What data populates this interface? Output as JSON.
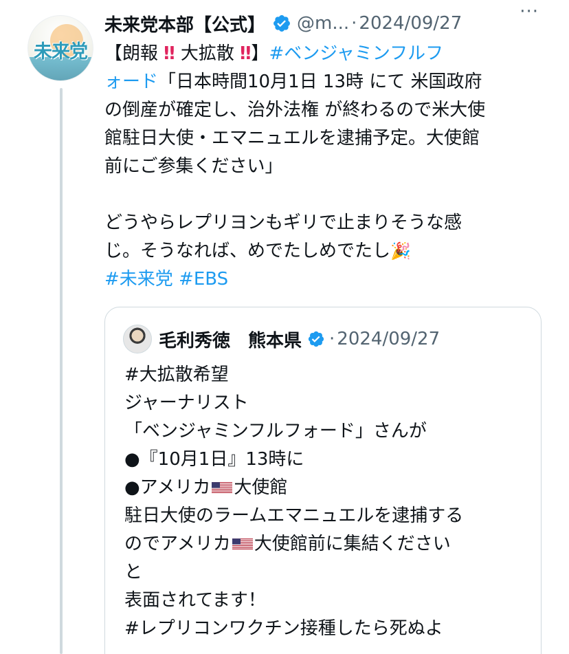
{
  "post": {
    "avatar_text": "未来党",
    "author_name": "未来党本部【公式】",
    "handle": "@m...",
    "separator": "·",
    "date": "2024/09/27",
    "more": "···",
    "lines": [
      [
        {
          "t": "【朗報 "
        },
        {
          "t": "‼",
          "c": "red"
        },
        {
          "t": " 大拡散 "
        },
        {
          "t": "‼",
          "c": "red"
        },
        {
          "t": "】"
        },
        {
          "t": "#ベンジャミンフルフ",
          "c": "blue"
        }
      ],
      [
        {
          "t": "ォード",
          "c": "blue"
        },
        {
          "t": "「日本時間10月1日 13時 にて 米国政府"
        }
      ],
      [
        {
          "t": "の倒産が確定し、治外法権 が終わるので米大使"
        }
      ],
      [
        {
          "t": "館駐日大使・エマニュエルを逮捕予定。大使館"
        }
      ],
      [
        {
          "t": "前にご参集ください」"
        }
      ],
      [
        {
          "t": ""
        }
      ],
      [
        {
          "t": "どうやらレプリヨンもギリで止まりそうな感"
        }
      ],
      [
        {
          "t": "じ。そうなれば、めでたしめでたし"
        },
        {
          "t": "🎉",
          "c": "emoji"
        }
      ],
      [
        {
          "t": "#未来党 #EBS",
          "c": "blue"
        }
      ]
    ]
  },
  "quote": {
    "author_name": "毛利秀徳　熊本県",
    "separator": "·",
    "date": "2024/09/27",
    "lines": [
      [
        {
          "t": "#大拡散希望"
        }
      ],
      [
        {
          "t": "ジャーナリスト"
        }
      ],
      [
        {
          "t": "「ベンジャミンフルフォード」さんが"
        }
      ],
      [
        {
          "t": "●『10月1日』13時に"
        }
      ],
      [
        {
          "t": "●アメリカ"
        },
        {
          "flag": "us-flag-icon"
        },
        {
          "t": "大使館"
        }
      ],
      [
        {
          "t": "駐日大使のラームエマニュエルを逮捕する"
        }
      ],
      [
        {
          "t": "のでアメリカ"
        },
        {
          "flag": "us-flag-icon"
        },
        {
          "t": "大使館前に集結ください"
        }
      ],
      [
        {
          "t": "と"
        }
      ],
      [
        {
          "t": "表面されてます！"
        }
      ],
      [
        {
          "t": "#レプリコンワクチン接種したら死ぬよ"
        }
      ]
    ]
  },
  "colors": {
    "link": "#1d9bf0",
    "muted": "#536471",
    "verified": "#1d9bf0",
    "alert": "#e0245e",
    "border": "#cfd9de"
  }
}
